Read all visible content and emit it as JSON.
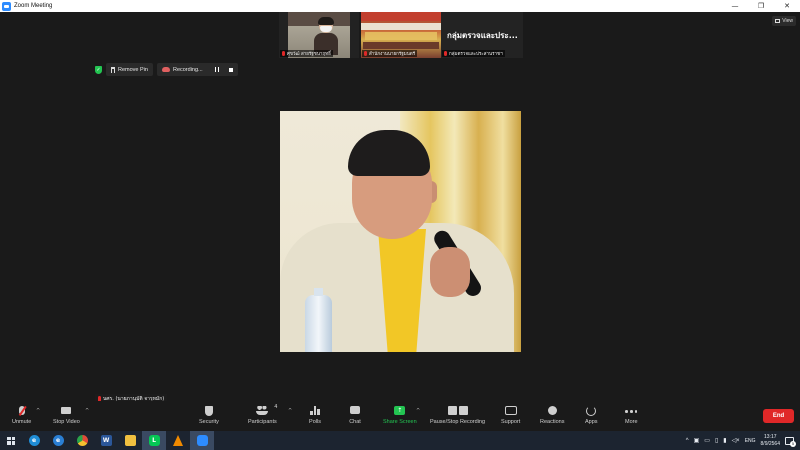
{
  "window": {
    "title": "Zoom Meeting",
    "controls": [
      "—",
      "❐",
      "✕"
    ]
  },
  "view_button": {
    "label": "View"
  },
  "thumbnails": [
    {
      "name": "ศุขวัฒ์ สายรัฐชนาฤทธิ์"
    },
    {
      "name": "สำนักงานนายกรัฐมนตรี",
      "display": "กลุ่มตรวจและประ...",
      "subname": "กลุ่มตรวจและประสานราชฯ"
    }
  ],
  "recording_bar": {
    "remove_pin": "Remove Pin",
    "recording": "Recording..."
  },
  "speaker_tag": {
    "name": "นศร. (นายภานุมัติ จารุหมัก)"
  },
  "toolbar": {
    "unmute": "Unmute",
    "stop_video": "Stop Video",
    "security": "Security",
    "participants": "Participants",
    "participants_count": "4",
    "polls": "Polls",
    "chat": "Chat",
    "share_screen": "Share Screen",
    "pause_stop_recording": "Pause/Stop Recording",
    "support": "Support",
    "reactions": "Reactions",
    "apps": "Apps",
    "more": "More",
    "end": "End"
  },
  "taskbar": {
    "apps": [
      {
        "name": "edge",
        "color": "#1f8dd6"
      },
      {
        "name": "ie",
        "color": "#2a7fd4"
      },
      {
        "name": "chrome",
        "color": "#e04a38"
      },
      {
        "name": "word",
        "color": "#2b579a"
      },
      {
        "name": "explorer",
        "color": "#f0c040"
      },
      {
        "name": "line",
        "color": "#06c755"
      },
      {
        "name": "vlc",
        "color": "#f08a00"
      },
      {
        "name": "zoom",
        "color": "#2d8cff"
      }
    ],
    "lang": "ENG",
    "time": "13:17",
    "date": "8/9/2564",
    "notifications": "5"
  }
}
